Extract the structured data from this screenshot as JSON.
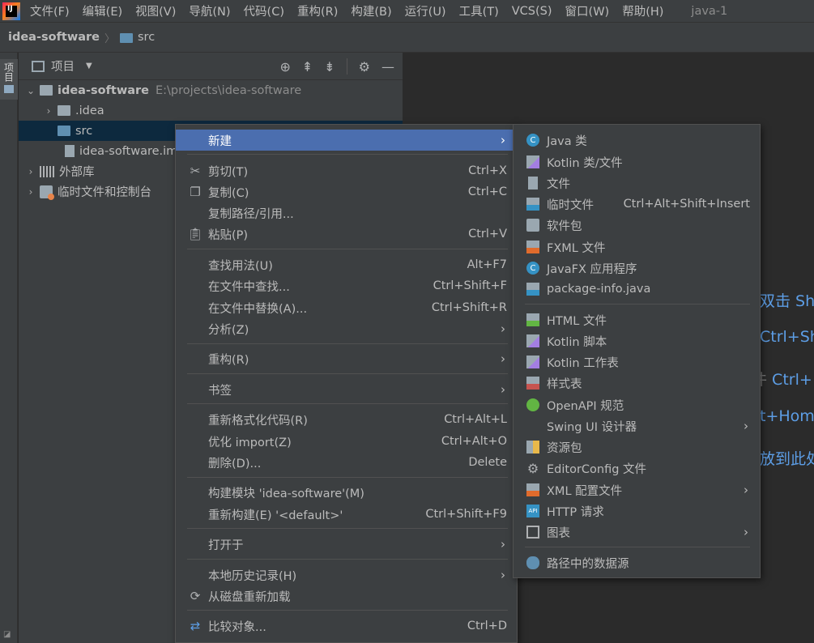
{
  "menubar": {
    "items": [
      "文件(F)",
      "编辑(E)",
      "视图(V)",
      "导航(N)",
      "代码(C)",
      "重构(R)",
      "构建(B)",
      "运行(U)",
      "工具(T)",
      "VCS(S)",
      "窗口(W)",
      "帮助(H)"
    ],
    "window_title": "java-1"
  },
  "breadcrumb": {
    "project": "idea-software",
    "folder": "src"
  },
  "stripe": {
    "tab_label": "项目"
  },
  "project_panel": {
    "title": "项目",
    "tree": [
      {
        "label": "idea-software",
        "path": "E:\\projects\\idea-software"
      },
      {
        "label": ".idea"
      },
      {
        "label": "src"
      },
      {
        "label": "idea-software.iml"
      },
      {
        "label": "外部库"
      },
      {
        "label": "临时文件和控制台"
      }
    ]
  },
  "editor_hints": [
    "双击 Sh",
    "Ctrl+Sh",
    "件 ",
    "Ctrl+",
    "t+Hom",
    "放到此处"
  ],
  "context_menu": {
    "items": [
      {
        "label": "新建",
        "shortcut": "",
        "submenu": true,
        "icon": ""
      },
      {
        "label": "剪切(T)",
        "shortcut": "Ctrl+X",
        "icon": "scissors-icon"
      },
      {
        "label": "复制(C)",
        "shortcut": "Ctrl+C",
        "icon": "copy-icon"
      },
      {
        "label": "复制路径/引用...",
        "shortcut": ""
      },
      {
        "label": "粘贴(P)",
        "shortcut": "Ctrl+V",
        "icon": "paste-icon"
      },
      {
        "label": "查找用法(U)",
        "shortcut": "Alt+F7"
      },
      {
        "label": "在文件中查找...",
        "shortcut": "Ctrl+Shift+F"
      },
      {
        "label": "在文件中替换(A)...",
        "shortcut": "Ctrl+Shift+R"
      },
      {
        "label": "分析(Z)",
        "submenu": true
      },
      {
        "label": "重构(R)",
        "submenu": true
      },
      {
        "label": "书签",
        "submenu": true
      },
      {
        "label": "重新格式化代码(R)",
        "shortcut": "Ctrl+Alt+L"
      },
      {
        "label": "优化 import(Z)",
        "shortcut": "Ctrl+Alt+O"
      },
      {
        "label": "删除(D)...",
        "shortcut": "Delete"
      },
      {
        "label": "构建模块 'idea-software'(M)",
        "shortcut": ""
      },
      {
        "label": "重新构建(E) '<default>'",
        "shortcut": "Ctrl+Shift+F9"
      },
      {
        "label": "打开于",
        "submenu": true
      },
      {
        "label": "本地历史记录(H)",
        "submenu": true
      },
      {
        "label": "从磁盘重新加载",
        "icon": "reload-icon"
      },
      {
        "label": "比较对象...",
        "shortcut": "Ctrl+D",
        "icon": "compare-icon"
      }
    ]
  },
  "new_submenu": {
    "items": [
      {
        "label": "Java 类",
        "icon": "java-class-icon"
      },
      {
        "label": "Kotlin 类/文件",
        "icon": "kotlin-file-icon"
      },
      {
        "label": "文件",
        "icon": "file-icon"
      },
      {
        "label": "临时文件",
        "shortcut": "Ctrl+Alt+Shift+Insert",
        "icon": "scratch-file-icon"
      },
      {
        "label": "软件包",
        "icon": "package-icon"
      },
      {
        "label": "FXML 文件",
        "icon": "fxml-file-icon"
      },
      {
        "label": "JavaFX 应用程序",
        "icon": "javafx-app-icon"
      },
      {
        "label": "package-info.java",
        "icon": "package-info-icon"
      },
      {
        "label": "HTML 文件",
        "icon": "html-file-icon"
      },
      {
        "label": "Kotlin 脚本",
        "icon": "kotlin-script-icon"
      },
      {
        "label": "Kotlin 工作表",
        "icon": "kotlin-worksheet-icon"
      },
      {
        "label": "样式表",
        "icon": "stylesheet-icon"
      },
      {
        "label": "OpenAPI 规范",
        "icon": "openapi-icon"
      },
      {
        "label": "Swing UI 设计器",
        "submenu": true
      },
      {
        "label": "资源包",
        "icon": "resource-bundle-icon"
      },
      {
        "label": "EditorConfig 文件",
        "icon": "gear-icon"
      },
      {
        "label": "XML 配置文件",
        "submenu": true,
        "icon": "xml-file-icon"
      },
      {
        "label": "HTTP 请求",
        "icon": "http-request-icon"
      },
      {
        "label": "图表",
        "submenu": true,
        "icon": "diagram-icon"
      },
      {
        "label": "路径中的数据源",
        "icon": "datasource-icon"
      }
    ]
  },
  "colors": {
    "selection": "#4b6eaf",
    "tree_selection": "#0d293e",
    "hint_blue": "#5d9ee6"
  }
}
